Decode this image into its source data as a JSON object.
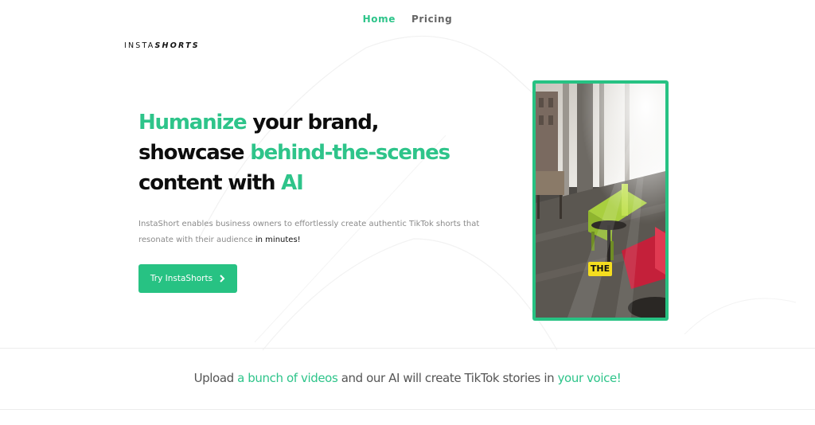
{
  "nav": {
    "home": "Home",
    "pricing": "Pricing"
  },
  "logo": {
    "light": "INSTA",
    "bold": "SHORTS"
  },
  "hero": {
    "h1": "Humanize",
    "h2": " your brand,",
    "h3": "showcase ",
    "h4": "behind-the-scenes",
    "h5": "content with ",
    "h6": "AI",
    "sub": "InstaShort enables business owners to effortlessly create authentic TikTok shorts that resonate with their audience ",
    "sub_em": "in minutes!",
    "cta": "Try InstaShorts"
  },
  "video": {
    "caption": "THE"
  },
  "tagline": {
    "t1": "Upload ",
    "t2": "a bunch of videos",
    "t3": " and our AI will create TikTok stories in ",
    "t4": "your voice!"
  },
  "colors": {
    "accent": "#2ec48a",
    "button": "#27c283"
  }
}
